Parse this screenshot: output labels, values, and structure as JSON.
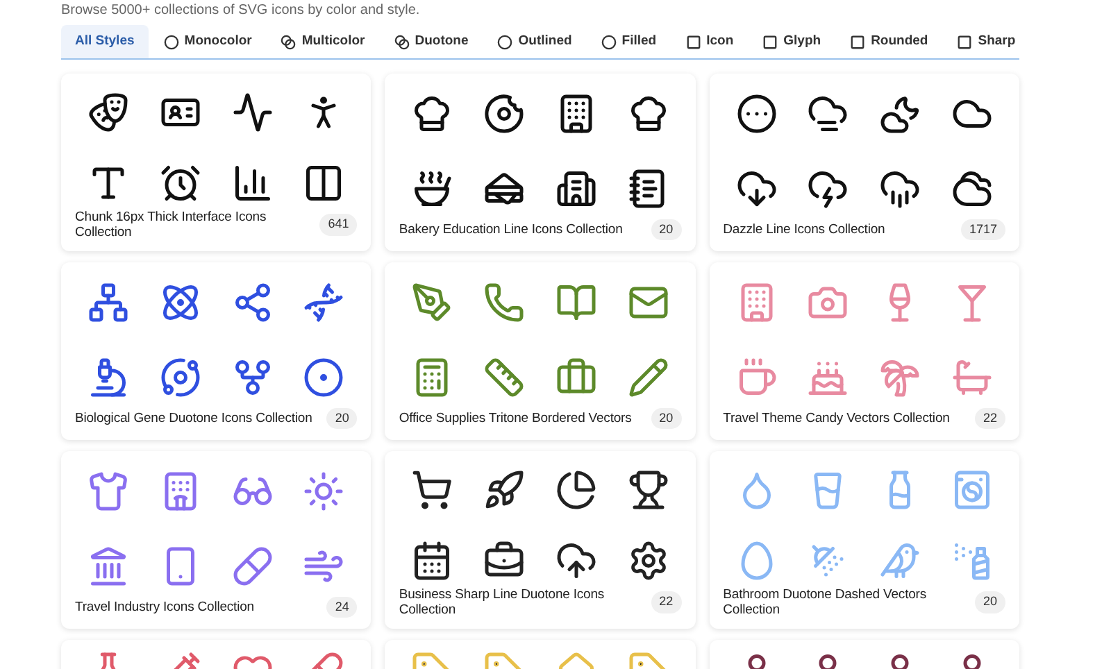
{
  "intro": "Browse 5000+ collections of SVG icons by color and style.",
  "tabs": [
    {
      "label": "All Styles",
      "selected": true
    },
    {
      "label": "Monocolor",
      "selected": false
    },
    {
      "label": "Multicolor",
      "selected": false
    },
    {
      "label": "Duotone",
      "selected": false
    },
    {
      "label": "Outlined",
      "selected": false
    },
    {
      "label": "Filled",
      "selected": false
    },
    {
      "label": "Icon",
      "selected": false
    },
    {
      "label": "Glyph",
      "selected": false
    },
    {
      "label": "Rounded",
      "selected": false
    },
    {
      "label": "Sharp",
      "selected": false
    }
  ],
  "collections": [
    {
      "title": "Chunk 16px Thick Interface Icons Collection",
      "count": "641"
    },
    {
      "title": "Bakery Education Line Icons Collection",
      "count": "20"
    },
    {
      "title": "Dazzle Line Icons Collection",
      "count": "1717"
    },
    {
      "title": "Biological Gene Duotone Icons Collection",
      "count": "20"
    },
    {
      "title": "Office Supplies Tritone Bordered Vectors",
      "count": "20"
    },
    {
      "title": "Travel Theme Candy Vectors Collection",
      "count": "22"
    },
    {
      "title": "Travel Industry Icons Collection",
      "count": "24"
    },
    {
      "title": "Business Sharp Line Duotone Icons Collection",
      "count": "22"
    },
    {
      "title": "Bathroom Duotone Dashed Vectors Collection",
      "count": "20"
    }
  ]
}
